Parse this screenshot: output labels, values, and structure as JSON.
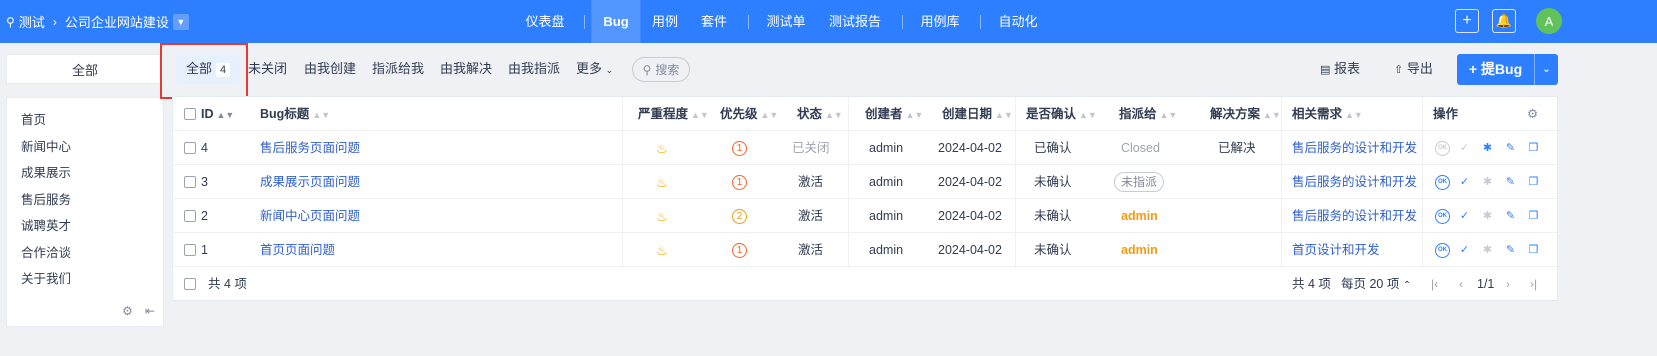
{
  "topbar": {
    "project_prefix": "测试",
    "project_name": "公司企业网站建设",
    "nav": [
      "仪表盘",
      "Bug",
      "用例",
      "套件",
      "测试单",
      "测试报告",
      "用例库",
      "自动化"
    ],
    "active_nav": "Bug",
    "avatar": "A",
    "color": "#2e7fff"
  },
  "sidebar": {
    "title": "全部",
    "items": [
      "首页",
      "新闻中心",
      "成果展示",
      "售后服务",
      "诚聘英才",
      "合作洽谈",
      "关于我们"
    ]
  },
  "tabs": [
    {
      "label": "全部",
      "count": "4"
    },
    {
      "label": "未关闭"
    },
    {
      "label": "由我创建"
    },
    {
      "label": "指派给我"
    },
    {
      "label": "由我解决"
    },
    {
      "label": "由我指派"
    },
    {
      "label": "更多"
    }
  ],
  "search_label": "搜索",
  "actions": {
    "report": "报表",
    "export": "导出",
    "new_bug": "提Bug"
  },
  "table": {
    "headers": [
      "ID",
      "Bug标题",
      "严重程度",
      "优先级",
      "状态",
      "创建者",
      "创建日期",
      "是否确认",
      "指派给",
      "解决方案",
      "相关需求",
      "操作"
    ],
    "rows": [
      {
        "id": "4",
        "title": "售后服务页面问题",
        "severity": "3",
        "priority": "1",
        "status": "已关闭",
        "creator": "admin",
        "date": "2024-04-02",
        "confirmed": "已确认",
        "assigned": "Closed",
        "resolution": "已解决",
        "story": "售后服务的设计和开发"
      },
      {
        "id": "3",
        "title": "成果展示页面问题",
        "severity": "3",
        "priority": "1",
        "status": "激活",
        "creator": "admin",
        "date": "2024-04-02",
        "confirmed": "未确认",
        "assigned": "未指派",
        "resolution": "",
        "story": "售后服务的设计和开发"
      },
      {
        "id": "2",
        "title": "新闻中心页面问题",
        "severity": "3",
        "priority": "2",
        "status": "激活",
        "creator": "admin",
        "date": "2024-04-02",
        "confirmed": "未确认",
        "assigned": "admin",
        "resolution": "",
        "story": "售后服务的设计和开发"
      },
      {
        "id": "1",
        "title": "首页页面问题",
        "severity": "3",
        "priority": "1",
        "status": "激活",
        "creator": "admin",
        "date": "2024-04-02",
        "confirmed": "未确认",
        "assigned": "admin",
        "resolution": "",
        "story": "首页设计和开发"
      }
    ]
  },
  "footer": {
    "select_count": "共 4 项",
    "total": "共 4 项",
    "per_page": "每页 20 项",
    "page": "1/1"
  }
}
